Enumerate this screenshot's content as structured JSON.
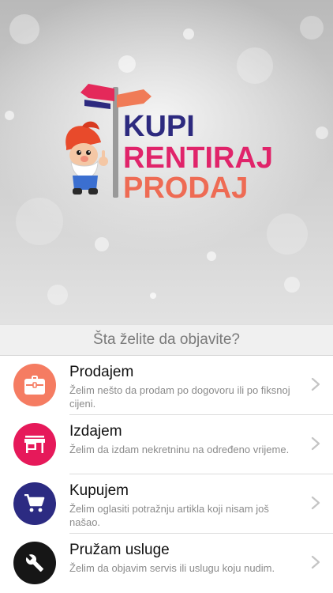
{
  "logo": {
    "line1": "KUPI",
    "line2": "RENTIRAJ",
    "line3": "PRODAJ",
    "colors": {
      "kupi": "#2d2a7f",
      "rentiraj": "#e0246a",
      "prodaj": "#ee6b54",
      "sign_left": "#e4295a",
      "sign_right": "#f07b57",
      "post": "#9a9a9a"
    }
  },
  "section": {
    "title": "Šta želite da objavite?"
  },
  "options": [
    {
      "title": "Prodajem",
      "description": "Želim nešto da prodam po dogovoru ili po fiksnoj cijeni.",
      "icon": "briefcase-icon",
      "color": "#f57c62"
    },
    {
      "title": "Izdajem",
      "description": "Želim da izdam nekretninu na određeno vrijeme.",
      "icon": "store-icon",
      "color": "#e6195a"
    },
    {
      "title": "Kupujem",
      "description": "Želim oglasiti potražnju artikla koji nisam još našao.",
      "icon": "cart-icon",
      "color": "#2c2b82"
    },
    {
      "title": "Pružam usluge",
      "description": "Želim da objavim servis ili uslugu koju nudim.",
      "icon": "wrench-icon",
      "color": "#161616"
    }
  ]
}
